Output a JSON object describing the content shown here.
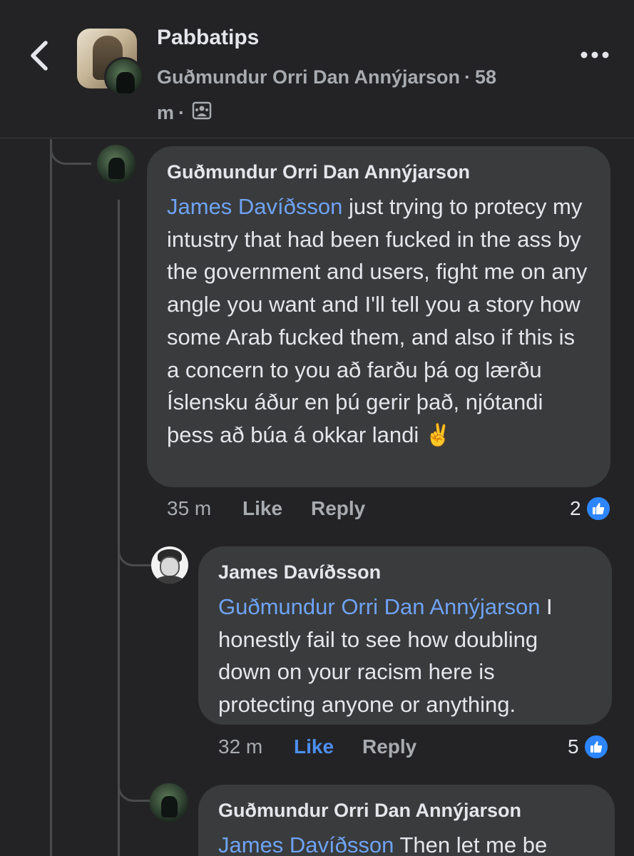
{
  "header": {
    "group_name": "Pabbatips",
    "poster_name": "Guðmundur Orri Dan Annýjarson",
    "separator": "·",
    "time_prefix": "58",
    "time_suffix": "m",
    "back_icon": "chevron-left-icon",
    "more_icon": "more-horizontal-icon",
    "audience_icon": "group-members-icon"
  },
  "comments": [
    {
      "author": "Guðmundur Orri Dan Annýjarson",
      "mention": "James Davíðsson",
      "text": " just trying to protecy my intustry that had been fucked in the ass by the government and users, fight me on any angle you want and I'll tell you a story how some Arab fucked them, and also if this is a concern to you að farðu þá og lærðu Íslensku áður en þú gerir það, njótandi þess að búa á okkar landi ",
      "emoji": "✌️",
      "time": "35 m",
      "like_label": "Like",
      "reply_label": "Reply",
      "reaction_count": "2",
      "liked_by_viewer": false
    },
    {
      "author": "James Davíðsson",
      "mention": "Guðmundur Orri Dan Annýjarson",
      "text": " I honestly fail to see how doubling down on your racism here  is protecting anyone or anything.",
      "time": "32 m",
      "like_label": "Like",
      "reply_label": "Reply",
      "reaction_count": "5",
      "liked_by_viewer": true
    },
    {
      "author": "Guðmundur Orri Dan Annýjarson",
      "mention": "James Davíðsson",
      "text": " Then let me be"
    }
  ],
  "colors": {
    "background": "#232325",
    "bubble": "#3a3b3c",
    "mention": "#6ea3f5",
    "like_active": "#4d8ff0",
    "reaction_badge": "#2d86ff",
    "muted_text": "#a8abaf"
  }
}
